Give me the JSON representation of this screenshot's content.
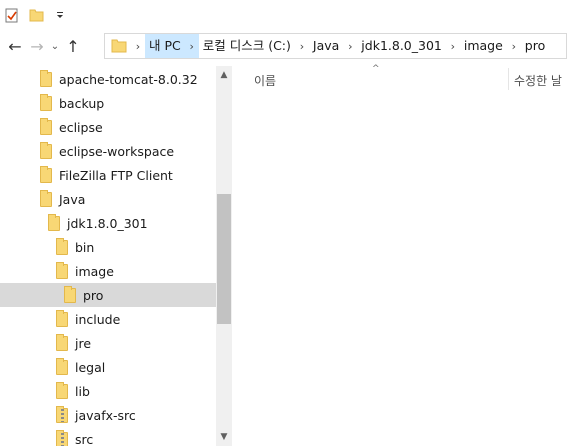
{
  "quick_access": {
    "icons": [
      "properties-icon",
      "new-folder-icon",
      "customize-dropdown-icon"
    ]
  },
  "nav": {
    "back_glyph": "←",
    "forward_glyph": "→",
    "recent_glyph": "⌄",
    "up_glyph": "↑"
  },
  "address": {
    "pc_label": "내 PC",
    "crumbs": [
      "로컬 디스크 (C:)",
      "Java",
      "jdk1.8.0_301",
      "image",
      "pro"
    ],
    "sep": "›"
  },
  "tree": {
    "items": [
      {
        "label": "apache-tomcat-8.0.32",
        "level": 0,
        "icon": "folder-icon"
      },
      {
        "label": "backup",
        "level": 0,
        "icon": "folder-icon"
      },
      {
        "label": "eclipse",
        "level": 0,
        "icon": "folder-icon"
      },
      {
        "label": "eclipse-workspace",
        "level": 0,
        "icon": "folder-icon"
      },
      {
        "label": "FileZilla FTP Client",
        "level": 0,
        "icon": "folder-icon"
      },
      {
        "label": "Java",
        "level": 0,
        "icon": "folder-icon"
      },
      {
        "label": "jdk1.8.0_301",
        "level": 1,
        "icon": "folder-icon"
      },
      {
        "label": "bin",
        "level": 2,
        "icon": "folder-icon"
      },
      {
        "label": "image",
        "level": 2,
        "icon": "folder-icon"
      },
      {
        "label": "pro",
        "level": 3,
        "icon": "folder-icon",
        "selected": true
      },
      {
        "label": "include",
        "level": 2,
        "icon": "folder-icon"
      },
      {
        "label": "jre",
        "level": 2,
        "icon": "folder-icon"
      },
      {
        "label": "legal",
        "level": 2,
        "icon": "folder-icon"
      },
      {
        "label": "lib",
        "level": 2,
        "icon": "folder-icon"
      },
      {
        "label": "javafx-src",
        "level": 2,
        "icon": "zip-folder-icon"
      },
      {
        "label": "src",
        "level": 2,
        "icon": "zip-folder-icon"
      }
    ]
  },
  "content": {
    "col_name": "이름",
    "col_date": "수정한 날",
    "sort_glyph": "^"
  }
}
